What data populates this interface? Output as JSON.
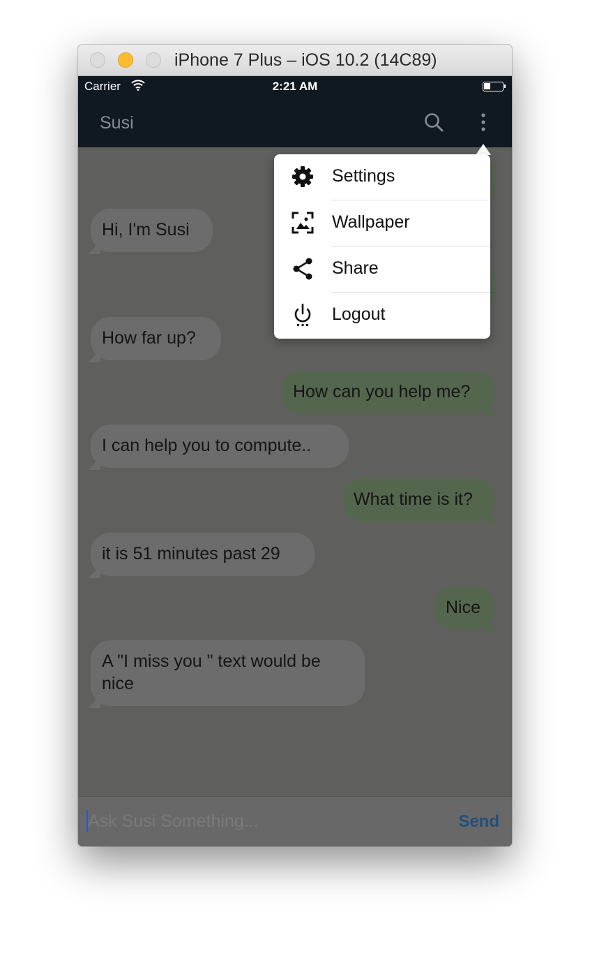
{
  "window": {
    "title": "iPhone 7 Plus – iOS 10.2 (14C89)"
  },
  "statusbar": {
    "carrier": "Carrier",
    "time": "2:21 AM"
  },
  "appbar": {
    "title": "Susi",
    "search_icon": "search-icon",
    "more_icon": "more-vertical-icon"
  },
  "menu": {
    "items": [
      {
        "label": "Settings",
        "icon": "gear-icon"
      },
      {
        "label": "Wallpaper",
        "icon": "wallpaper-icon"
      },
      {
        "label": "Share",
        "icon": "share-icon"
      },
      {
        "label": "Logout",
        "icon": "power-icon"
      }
    ]
  },
  "messages": [
    {
      "from": "susi",
      "text": "Hi, I'm Susi"
    },
    {
      "from": "susi",
      "text": "How far up?"
    },
    {
      "from": "user",
      "text": "How can you help me?"
    },
    {
      "from": "susi",
      "text": "I can help you to compute.."
    },
    {
      "from": "user",
      "text": "What time is it?"
    },
    {
      "from": "susi",
      "text": "it is 51 minutes past 29"
    },
    {
      "from": "user",
      "text": "Nice"
    },
    {
      "from": "susi",
      "text": "A \"I miss you \" text would be nice"
    }
  ],
  "input": {
    "placeholder": "Ask Susi Something...",
    "send_label": "Send"
  },
  "colors": {
    "appbar": "#101820",
    "chat_background": "#5f5f5d",
    "bubble_incoming": "#6c6c6c",
    "bubble_outgoing": "#55664f",
    "send": "#254e7a",
    "traffic_light_yellow": "#febc2e"
  }
}
